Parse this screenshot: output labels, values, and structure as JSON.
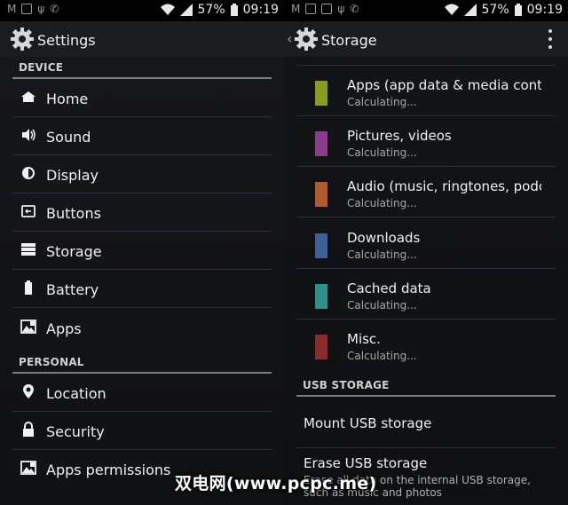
{
  "status_left": {
    "battery": "57%",
    "time": "09:19"
  },
  "status_right": {
    "battery": "57%",
    "time": "09:19"
  },
  "settings": {
    "title": "Settings",
    "section_device": "DEVICE",
    "section_personal": "PERSONAL",
    "items": [
      {
        "label": "Home",
        "icon": "home-icon"
      },
      {
        "label": "Sound",
        "icon": "sound-icon"
      },
      {
        "label": "Display",
        "icon": "display-icon"
      },
      {
        "label": "Buttons",
        "icon": "buttons-icon"
      },
      {
        "label": "Storage",
        "icon": "storage-icon"
      },
      {
        "label": "Battery",
        "icon": "battery-icon"
      },
      {
        "label": "Apps",
        "icon": "apps-icon"
      }
    ],
    "personal_items": [
      {
        "label": "Location",
        "icon": "location-icon"
      },
      {
        "label": "Security",
        "icon": "lock-icon"
      },
      {
        "label": "Apps permissions",
        "icon": "apps-permissions-icon"
      }
    ]
  },
  "storage": {
    "title": "Storage",
    "items": [
      {
        "title": "Apps (app data & media content)",
        "sub": "Calculating...",
        "color": "#8c9c1f"
      },
      {
        "title": "Pictures, videos",
        "sub": "Calculating...",
        "color": "#8b3b8c"
      },
      {
        "title": "Audio (music, ringtones, podcasts, etc.)",
        "sub": "Calculating...",
        "color": "#b45a2a"
      },
      {
        "title": "Downloads",
        "sub": "Calculating...",
        "color": "#3f5f9a"
      },
      {
        "title": "Cached data",
        "sub": "Calculating...",
        "color": "#2f8f8b"
      },
      {
        "title": "Misc.",
        "sub": "Calculating...",
        "color": "#8a2a2c"
      }
    ],
    "usb_section": "USB STORAGE",
    "mount": "Mount USB storage",
    "erase_title": "Erase USB storage",
    "erase_sub": "Erase all data on the internal USB storage, such as music and photos"
  },
  "watermark": "双电网(www.pcpc.me)",
  "colors": {
    "divider": "#2d3034",
    "section_line": "#7a7d82"
  }
}
